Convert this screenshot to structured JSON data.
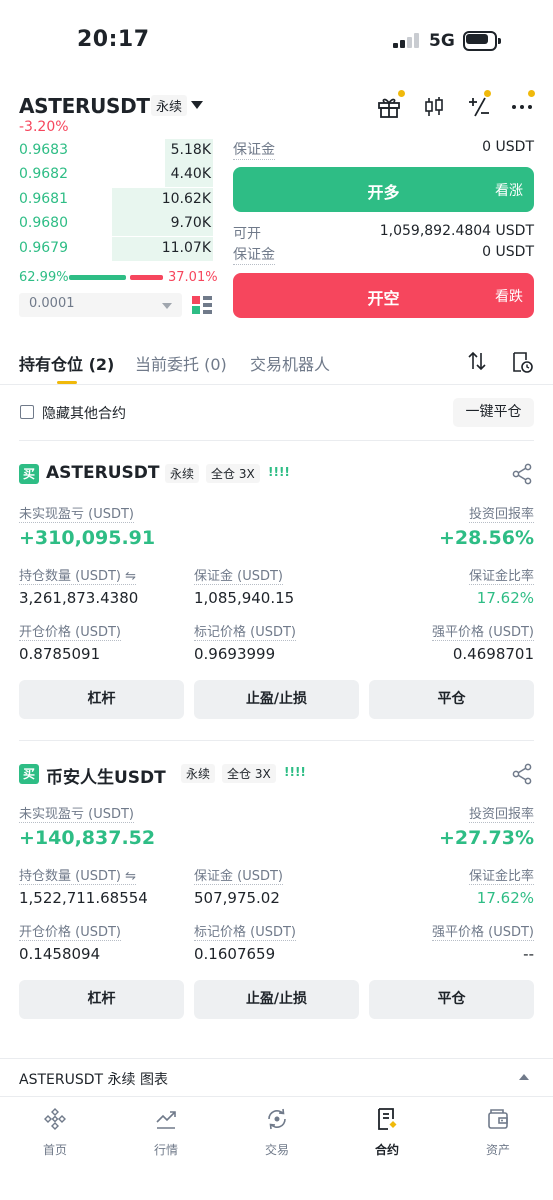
{
  "status": {
    "time": "20:17",
    "network": "5G"
  },
  "header": {
    "symbol": "ASTERUSDT",
    "perp_tag": "永续",
    "change": "-3.20%"
  },
  "orderbook": {
    "rows": [
      {
        "price": "0.9683",
        "qty": "5.18K",
        "depth": 0.25
      },
      {
        "price": "0.9682",
        "qty": "4.40K",
        "depth": 0.25
      },
      {
        "price": "0.9681",
        "qty": "10.62K",
        "depth": 0.52
      },
      {
        "price": "0.9680",
        "qty": "9.70K",
        "depth": 0.52
      },
      {
        "price": "0.9679",
        "qty": "11.07K",
        "depth": 0.52
      }
    ],
    "buy_ratio": "62.99%",
    "sell_ratio": "37.01%",
    "precision": "0.0001"
  },
  "order_panel": {
    "margin_label_top": "保证金",
    "margin_value_top": "0 USDT",
    "long_label": "开多",
    "long_sub": "看涨",
    "available_label": "可开",
    "available_value": "1,059,892.4804 USDT",
    "margin_label": "保证金",
    "margin_value": "0 USDT",
    "short_label": "开空",
    "short_sub": "看跌"
  },
  "tabs": [
    {
      "label": "持有仓位 (2)"
    },
    {
      "label": "当前委托 (0)"
    },
    {
      "label": "交易机器人"
    }
  ],
  "filter": {
    "hide_label": "隐藏其他合约",
    "close_all": "一键平仓"
  },
  "positions": [
    {
      "side": "买",
      "symbol": "ASTERUSDT",
      "perp": "永续",
      "mode": "全仓 3X",
      "bars": "!!!!",
      "pnl_label": "未实现盈亏 (USDT)",
      "pnl": "+310,095.91",
      "roe_label": "投资回报率",
      "roe": "+28.56%",
      "size_label": "持仓数量 (USDT) ⇋",
      "size": "3,261,873.4380",
      "margin_label": "保证金 (USDT)",
      "margin": "1,085,940.15",
      "margin_ratio_label": "保证金比率",
      "margin_ratio": "17.62%",
      "entry_label": "开仓价格 (USDT)",
      "entry": "0.8785091",
      "mark_label": "标记价格 (USDT)",
      "mark": "0.9693999",
      "liq_label": "强平价格 (USDT)",
      "liq": "0.4698701",
      "btn_leverage": "杠杆",
      "btn_tpsl": "止盈/止损",
      "btn_close": "平仓"
    },
    {
      "side": "买",
      "symbol": "币安人生USDT",
      "perp": "永续",
      "mode": "全仓 3X",
      "bars": "!!!!",
      "pnl_label": "未实现盈亏 (USDT)",
      "pnl": "+140,837.52",
      "roe_label": "投资回报率",
      "roe": "+27.73%",
      "size_label": "持仓数量 (USDT) ⇋",
      "size": "1,522,711.68554",
      "margin_label": "保证金 (USDT)",
      "margin": "507,975.02",
      "margin_ratio_label": "保证金比率",
      "margin_ratio": "17.62%",
      "entry_label": "开仓价格 (USDT)",
      "entry": "0.1458094",
      "mark_label": "标记价格 (USDT)",
      "mark": "0.1607659",
      "liq_label": "强平价格 (USDT)",
      "liq": "--",
      "btn_leverage": "杠杆",
      "btn_tpsl": "止盈/止损",
      "btn_close": "平仓"
    }
  ],
  "chart_bar": {
    "label": "ASTERUSDT 永续  图表"
  },
  "nav": [
    {
      "label": "首页",
      "icon": "home-icon"
    },
    {
      "label": "行情",
      "icon": "markets-icon"
    },
    {
      "label": "交易",
      "icon": "trade-icon"
    },
    {
      "label": "合约",
      "icon": "futures-icon"
    },
    {
      "label": "资产",
      "icon": "wallet-icon"
    }
  ],
  "colors": {
    "green": "#2ebd85",
    "red": "#f6465d",
    "yellow": "#f0b90b"
  }
}
